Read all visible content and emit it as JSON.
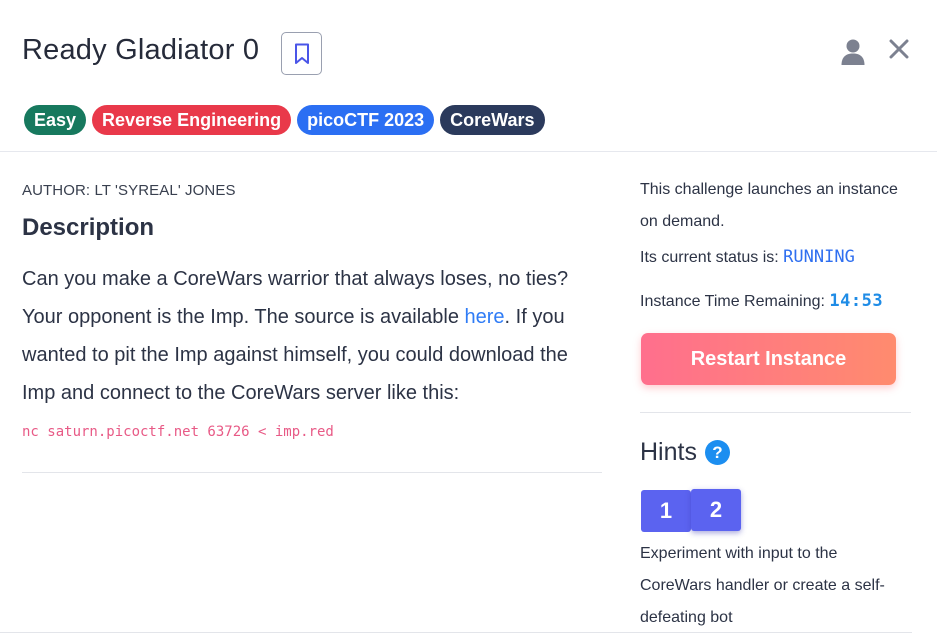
{
  "header": {
    "title": "Ready Gladiator 0",
    "tags": [
      {
        "label": "Easy",
        "color": "#17795e"
      },
      {
        "label": "Reverse Engineering",
        "color": "#e9394a"
      },
      {
        "label": "picoCTF 2023",
        "color": "#2b6ff3"
      },
      {
        "label": "CoreWars",
        "color": "#2b3a5c"
      }
    ],
    "icons": {
      "bookmark": "bookmark-icon",
      "user": "user-icon",
      "close": "close-icon"
    }
  },
  "description": {
    "author": "AUTHOR: LT 'SYREAL' JONES",
    "heading": "Description",
    "text_before_link": "Can you make a CoreWars warrior that always loses, no ties? Your opponent is the Imp. The source is available ",
    "link_text": "here",
    "text_after_link": ". If you wanted to pit the Imp against himself, you could download the Imp and connect to the CoreWars server like this:",
    "command": "nc saturn.picoctf.net 63726 < imp.red"
  },
  "instance": {
    "launch_text": "This challenge launches an instance on demand.",
    "status_label": "Its current status is: ",
    "status_value": "RUNNING",
    "time_label": "Instance Time Remaining: ",
    "time_value": "14:53",
    "restart_label": "Restart Instance"
  },
  "hints": {
    "heading": "Hints",
    "help_icon": "?",
    "tabs": [
      "1",
      "2"
    ],
    "active_tab": "2",
    "text": "Experiment with input to the CoreWars handler or create a self-defeating bot"
  }
}
